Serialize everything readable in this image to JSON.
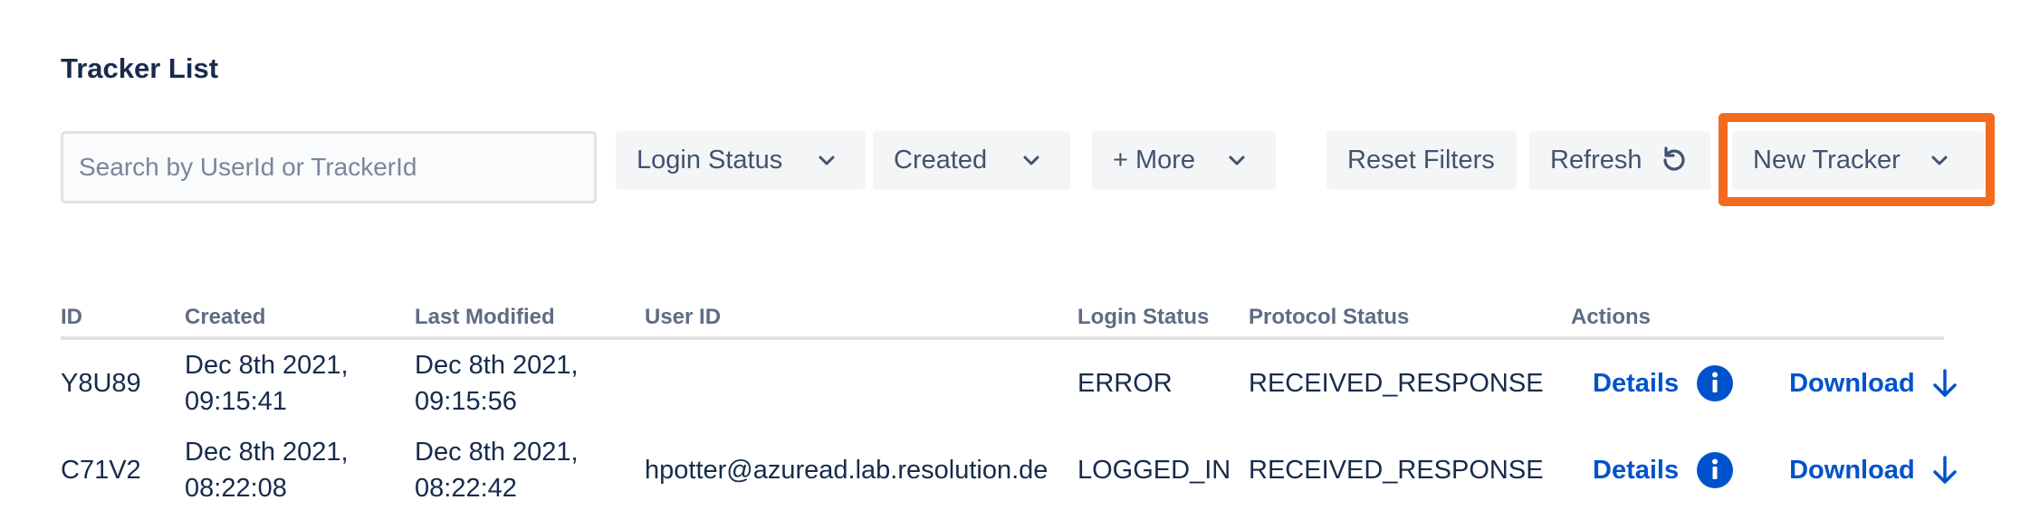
{
  "page": {
    "title": "Tracker List"
  },
  "search": {
    "placeholder": "Search by UserId or TrackerId",
    "value": ""
  },
  "filters": {
    "login_status": "Login Status",
    "created": "Created",
    "more": "+ More"
  },
  "toolbar": {
    "reset_filters": "Reset Filters",
    "refresh": "Refresh",
    "new_tracker": "New Tracker"
  },
  "table": {
    "columns": [
      "ID",
      "Created",
      "Last Modified",
      "User ID",
      "Login Status",
      "Protocol Status",
      "Actions"
    ],
    "rows": [
      {
        "id": "Y8U89",
        "created_date": "Dec 8th 2021,",
        "created_time": "09:15:41",
        "modified_date": "Dec 8th 2021,",
        "modified_time": "09:15:56",
        "user_id": "",
        "login_status": "ERROR",
        "protocol_status": "RECEIVED_RESPONSE",
        "details": "Details",
        "download": "Download"
      },
      {
        "id": "C71V2",
        "created_date": "Dec 8th 2021,",
        "created_time": "08:22:08",
        "modified_date": "Dec 8th 2021,",
        "modified_time": "08:22:42",
        "user_id": "hpotter@azuread.lab.resolution.de",
        "login_status": "LOGGED_IN",
        "protocol_status": "RECEIVED_RESPONSE",
        "details": "Details",
        "download": "Download"
      }
    ]
  },
  "icons": {
    "chevron": "chevron-down-icon",
    "refresh": "refresh-icon",
    "info": "info-icon",
    "download": "arrow-down-icon"
  },
  "colors": {
    "text": "#172b4d",
    "link": "#0052cc",
    "button_bg": "#f4f5f7",
    "highlight_border": "#f26b1d",
    "header_text": "#5e6c84"
  }
}
